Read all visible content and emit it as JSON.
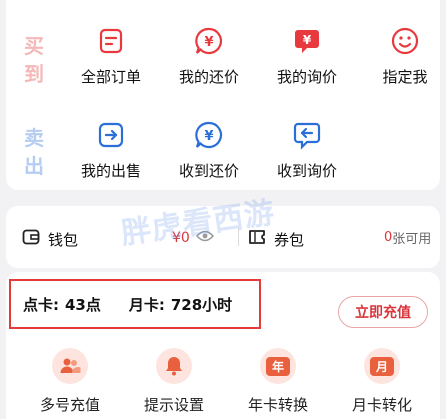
{
  "orders": {
    "buy_label": [
      "买",
      "到"
    ],
    "sell_label": [
      "卖",
      "出"
    ],
    "buy_items": [
      {
        "label": "全部订单",
        "icon": "order-list-icon"
      },
      {
        "label": "我的还价",
        "icon": "bargain-icon"
      },
      {
        "label": "我的询价",
        "icon": "inquiry-icon"
      },
      {
        "label": "指定我",
        "icon": "smile-icon"
      }
    ],
    "sell_items": [
      {
        "label": "我的出售",
        "icon": "sell-arrow-icon"
      },
      {
        "label": "收到还价",
        "icon": "received-bargain-icon"
      },
      {
        "label": "收到询价",
        "icon": "received-inquiry-icon"
      }
    ]
  },
  "wallet": {
    "wallet_label": "钱包",
    "balance": "¥0",
    "coupon_label": "券包",
    "coupon_count": "0",
    "coupon_suffix": "张可用"
  },
  "account": {
    "point_card_label": "点卡:",
    "point_card_value": "43点",
    "month_card_label": "月卡:",
    "month_card_value": "728小时",
    "recharge_button": "立即充值"
  },
  "tools": [
    {
      "label": "多号充值",
      "icon": "multi-user-icon"
    },
    {
      "label": "提示设置",
      "icon": "bell-icon"
    },
    {
      "label": "年卡转换",
      "icon": "year-card-icon",
      "glyph": "年"
    },
    {
      "label": "月卡转化",
      "icon": "month-card-icon",
      "glyph": "月"
    }
  ],
  "watermark": "胖虎看西游",
  "colors": {
    "red": "#e8393f",
    "blue": "#2a6ed8",
    "buy_label": "#f5b8b8",
    "sell_label": "#b6cdf2",
    "highlight_border": "#e43a3a"
  }
}
